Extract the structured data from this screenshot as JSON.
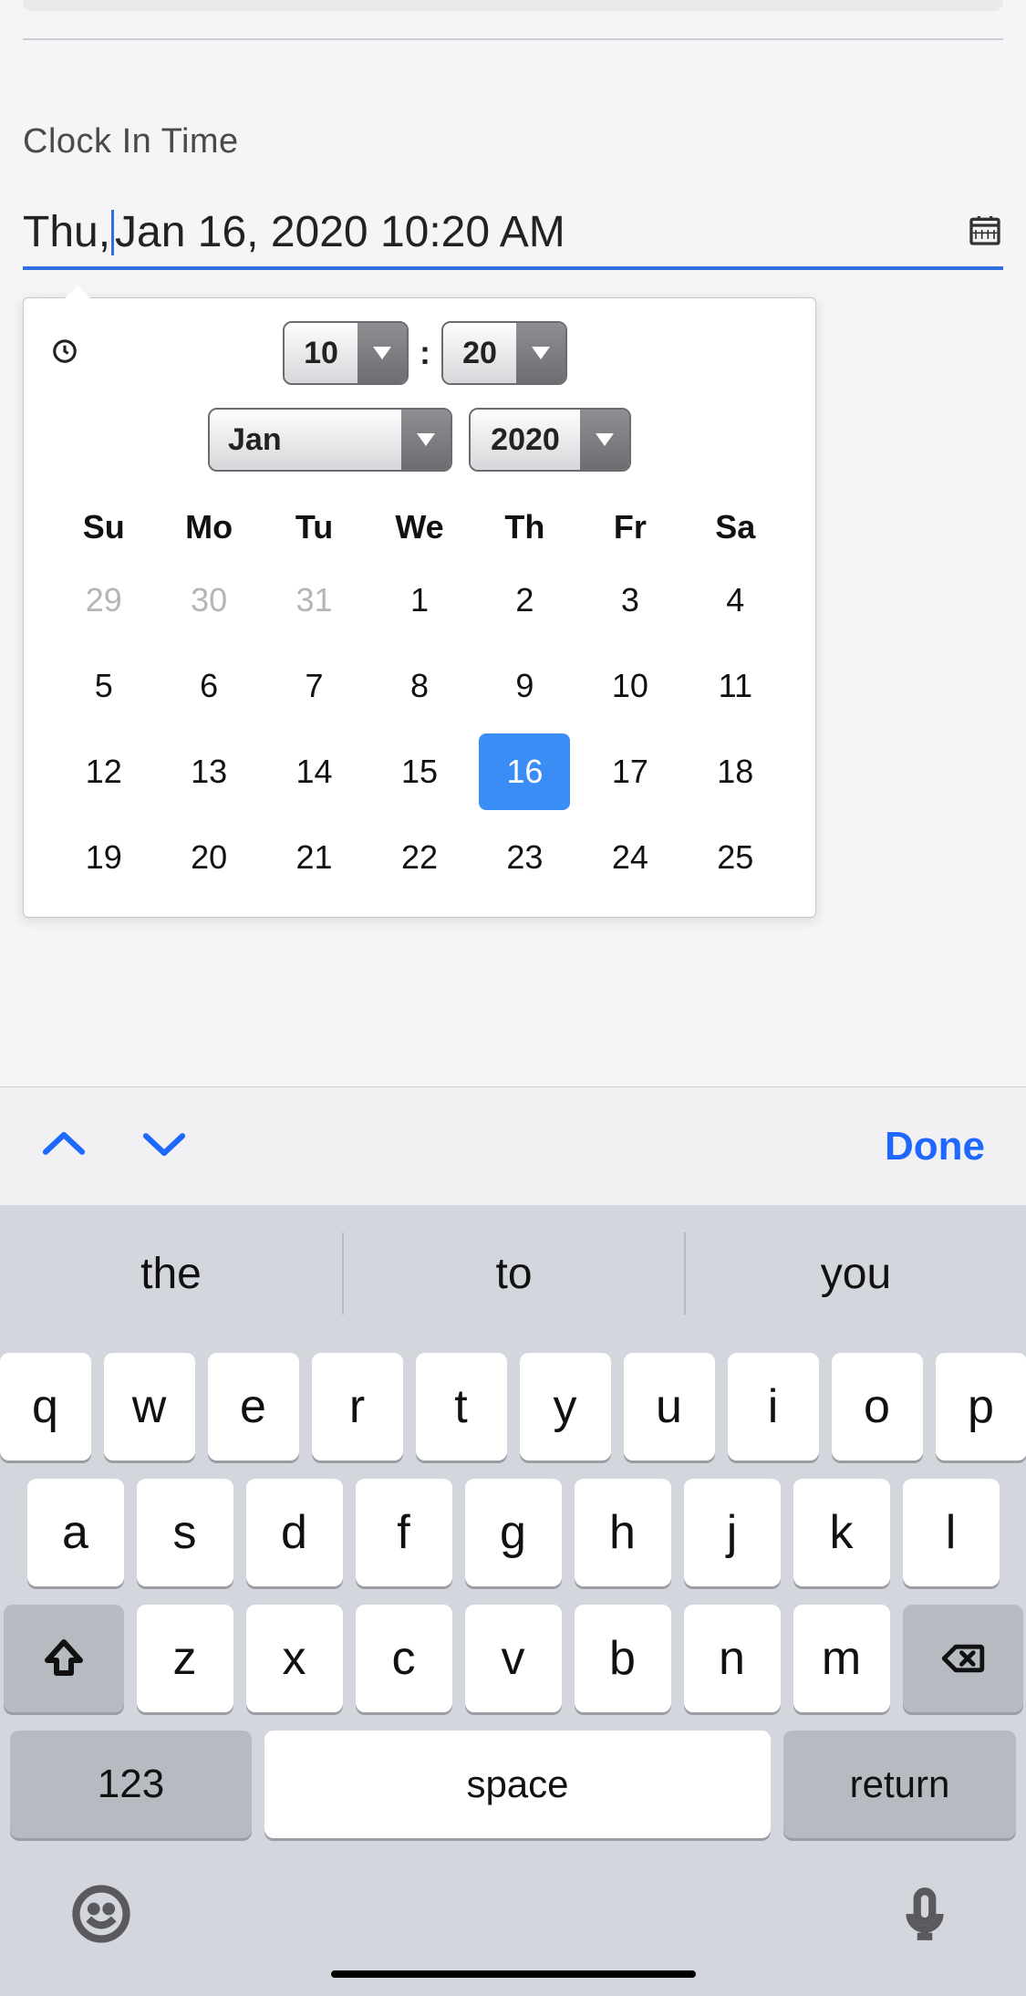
{
  "field": {
    "label": "Clock In Time"
  },
  "input": {
    "prefix": "Thu, ",
    "suffix": "Jan 16, 2020 10:20 AM"
  },
  "time": {
    "hour": "10",
    "minute": "20"
  },
  "monthYear": {
    "month": "Jan",
    "year": "2020"
  },
  "daysOfWeek": [
    "Su",
    "Mo",
    "Tu",
    "We",
    "Th",
    "Fr",
    "Sa"
  ],
  "weeks": [
    [
      {
        "n": "29",
        "other": true
      },
      {
        "n": "30",
        "other": true
      },
      {
        "n": "31",
        "other": true
      },
      {
        "n": "1"
      },
      {
        "n": "2"
      },
      {
        "n": "3"
      },
      {
        "n": "4"
      }
    ],
    [
      {
        "n": "5"
      },
      {
        "n": "6"
      },
      {
        "n": "7"
      },
      {
        "n": "8"
      },
      {
        "n": "9"
      },
      {
        "n": "10"
      },
      {
        "n": "11"
      }
    ],
    [
      {
        "n": "12"
      },
      {
        "n": "13"
      },
      {
        "n": "14"
      },
      {
        "n": "15"
      },
      {
        "n": "16",
        "selected": true
      },
      {
        "n": "17"
      },
      {
        "n": "18"
      }
    ],
    [
      {
        "n": "19"
      },
      {
        "n": "20"
      },
      {
        "n": "21"
      },
      {
        "n": "22"
      },
      {
        "n": "23"
      },
      {
        "n": "24"
      },
      {
        "n": "25"
      }
    ]
  ],
  "toolbar": {
    "done": "Done"
  },
  "suggestions": [
    "the",
    "to",
    "you"
  ],
  "keyboard": {
    "row1": [
      "q",
      "w",
      "e",
      "r",
      "t",
      "y",
      "u",
      "i",
      "o",
      "p"
    ],
    "row2": [
      "a",
      "s",
      "d",
      "f",
      "g",
      "h",
      "j",
      "k",
      "l"
    ],
    "row3": [
      "z",
      "x",
      "c",
      "v",
      "b",
      "n",
      "m"
    ],
    "numKey": "123",
    "space": "space",
    "return": "return"
  }
}
